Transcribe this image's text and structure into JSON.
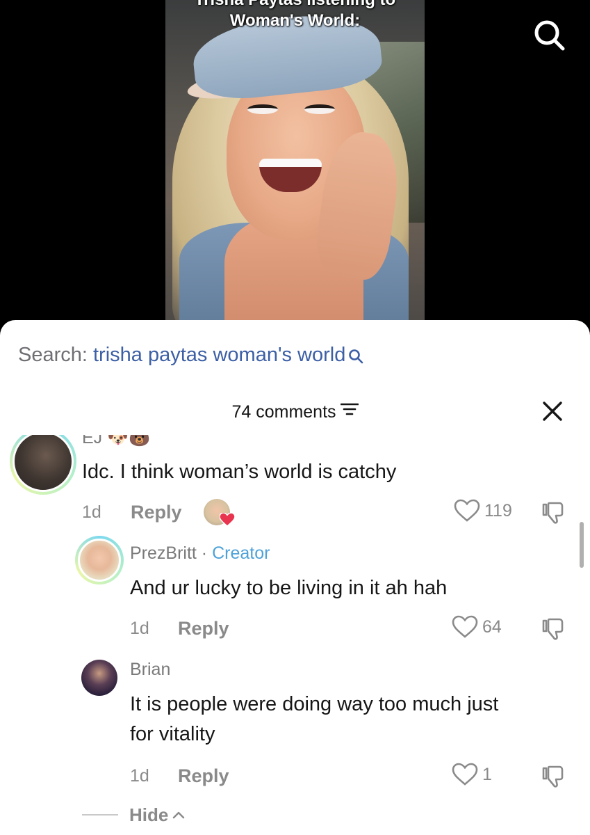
{
  "video": {
    "caption_line1": "Trisha Paytas listening to",
    "caption_line2": "Woman's World:"
  },
  "search": {
    "prefix": "Search: ",
    "query": "trisha paytas woman's world"
  },
  "comments_panel": {
    "count_label": "74 comments"
  },
  "comments": [
    {
      "author": "EJ",
      "author_emoji": "🐶🐻",
      "text": "Idc. I think woman’s world is catchy",
      "age": "1d",
      "reply_label": "Reply",
      "likes": "119"
    },
    {
      "author": "PrezBritt",
      "badge_sep": " · ",
      "badge": "Creator",
      "text": "And ur lucky to be living in it ah hah",
      "age": "1d",
      "reply_label": "Reply",
      "likes": "64"
    },
    {
      "author": "Brian",
      "text_line1": "It is people were doing way too much just",
      "text_line2": "for vitality",
      "age": "1d",
      "reply_label": "Reply",
      "likes": "1"
    }
  ],
  "replies_toggle": {
    "label": "Hide"
  },
  "colors": {
    "search_query": "#3c5fa5",
    "creator_badge": "#4ea2d8",
    "like_heart": "#e8344e"
  },
  "icons": [
    "search-icon",
    "filter-icon",
    "close-icon",
    "heart-icon",
    "dislike-icon",
    "chevron-up-icon"
  ]
}
